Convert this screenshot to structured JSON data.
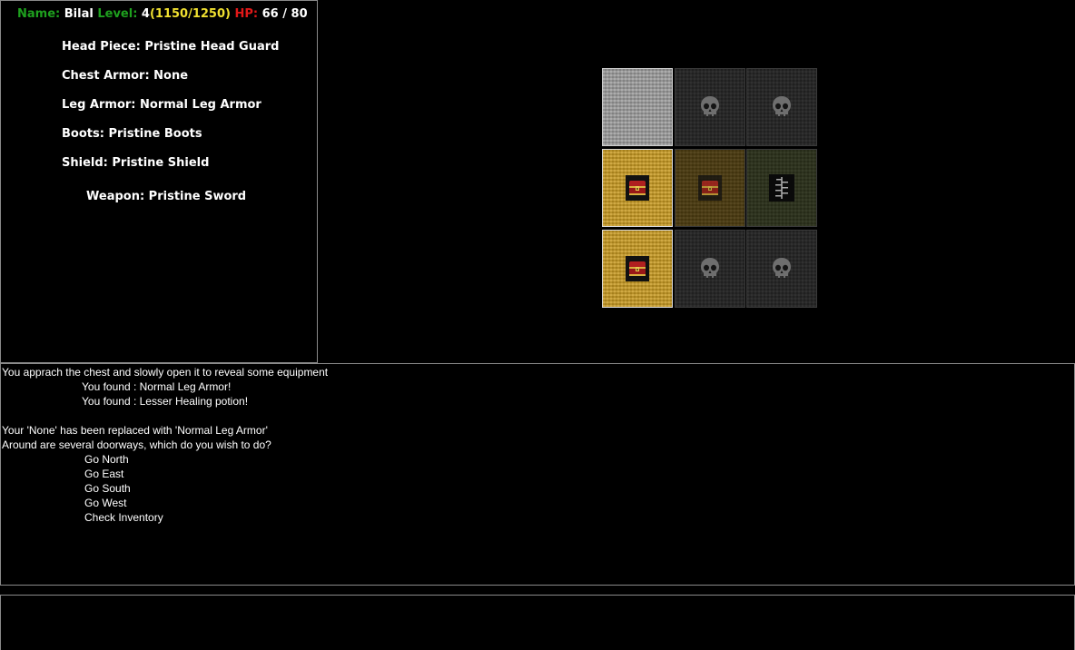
{
  "stats": {
    "name_label": "Name:",
    "name": "Bilal",
    "level_label": "Level:",
    "level": "4",
    "xp": "(1150/1250)",
    "hp_label": "HP:",
    "hp": "66 / 80"
  },
  "equipment": {
    "head": "Head Piece: Pristine Head Guard",
    "chest": "Chest Armor: None",
    "legs": "Leg Armor: Normal Leg Armor",
    "boots": "Boots: Pristine Boots",
    "shield": "Shield: Pristine Shield",
    "weapon": "Weapon: Pristine Sword"
  },
  "map": {
    "tiles": [
      {
        "row": 0,
        "col": 0,
        "floor": "stone",
        "icon": null
      },
      {
        "row": 0,
        "col": 1,
        "floor": "dark",
        "icon": "skull-icon"
      },
      {
        "row": 0,
        "col": 2,
        "floor": "dark",
        "icon": "skull-icon"
      },
      {
        "row": 1,
        "col": 0,
        "floor": "gold",
        "icon": "chest-icon"
      },
      {
        "row": 1,
        "col": 1,
        "floor": "dim-gold",
        "icon": "chest-icon"
      },
      {
        "row": 1,
        "col": 2,
        "floor": "moss",
        "icon": "stairs-icon"
      },
      {
        "row": 2,
        "col": 0,
        "floor": "gold",
        "icon": "chest-icon"
      },
      {
        "row": 2,
        "col": 1,
        "floor": "dark",
        "icon": "skull-icon"
      },
      {
        "row": 2,
        "col": 2,
        "floor": "dark",
        "icon": "skull-icon"
      }
    ]
  },
  "log": {
    "line1": "You apprach the chest and slowly open it to reveal some equipment",
    "found1": "You found : Normal Leg Armor!",
    "found2": "You found : Lesser Healing potion!",
    "replaced": "Your 'None' has been replaced with 'Normal Leg Armor'",
    "prompt": "Around are several doorways, which do you wish to do?",
    "options": [
      "Go North",
      "Go East",
      "Go South",
      "Go West",
      "Check Inventory"
    ]
  },
  "colors": {
    "label_green": "#1ea01e",
    "hp_red": "#e01818",
    "xp_yellow": "#f0e030",
    "panel_border": "#8a8a8a"
  }
}
